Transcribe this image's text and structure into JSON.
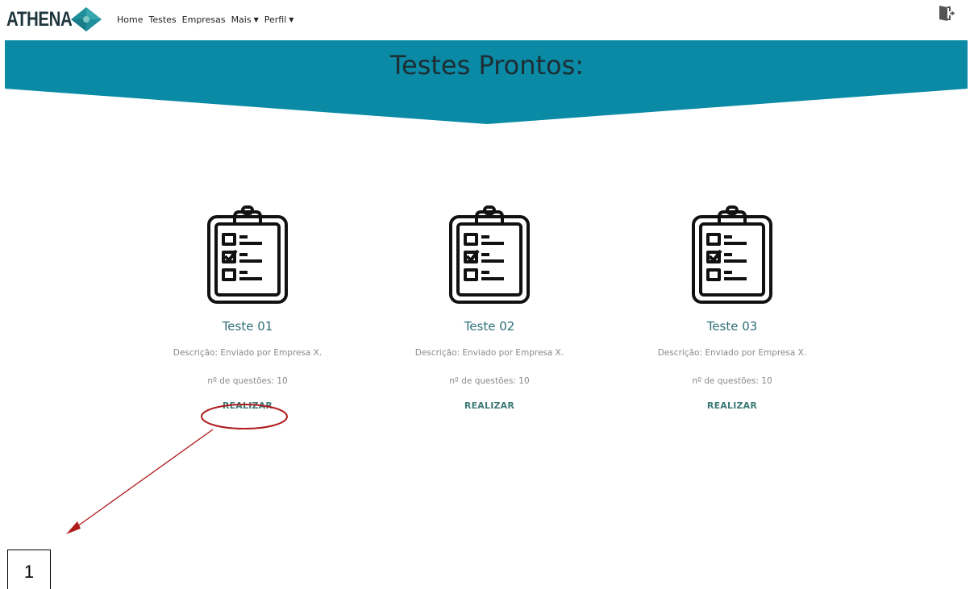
{
  "navbar": {
    "brand": "ATHENA",
    "links": [
      {
        "label": "Home"
      },
      {
        "label": "Testes"
      },
      {
        "label": "Empresas"
      },
      {
        "label": "Mais",
        "dropdown": true
      },
      {
        "label": "Perfil",
        "dropdown": true
      }
    ],
    "logout_icon": "logout-door-icon"
  },
  "banner": {
    "title": "Testes Prontos:",
    "color": "#0a8aa5"
  },
  "cards": [
    {
      "icon": "clipboard-checklist-icon",
      "title": "Teste 01",
      "description": "Descrição: Enviado por Empresa X.",
      "count": "nº de questões: 10",
      "action": "REALIZAR"
    },
    {
      "icon": "clipboard-checklist-icon",
      "title": "Teste 02",
      "description": "Descrição: Enviado por Empresa X.",
      "count": "nº de questões: 10",
      "action": "REALIZAR"
    },
    {
      "icon": "clipboard-checklist-icon",
      "title": "Teste 03",
      "description": "Descrição: Enviado por Empresa X.",
      "count": "nº de questões: 10",
      "action": "REALIZAR"
    }
  ],
  "annotation": {
    "label": "1",
    "color": "#b01c1c"
  }
}
